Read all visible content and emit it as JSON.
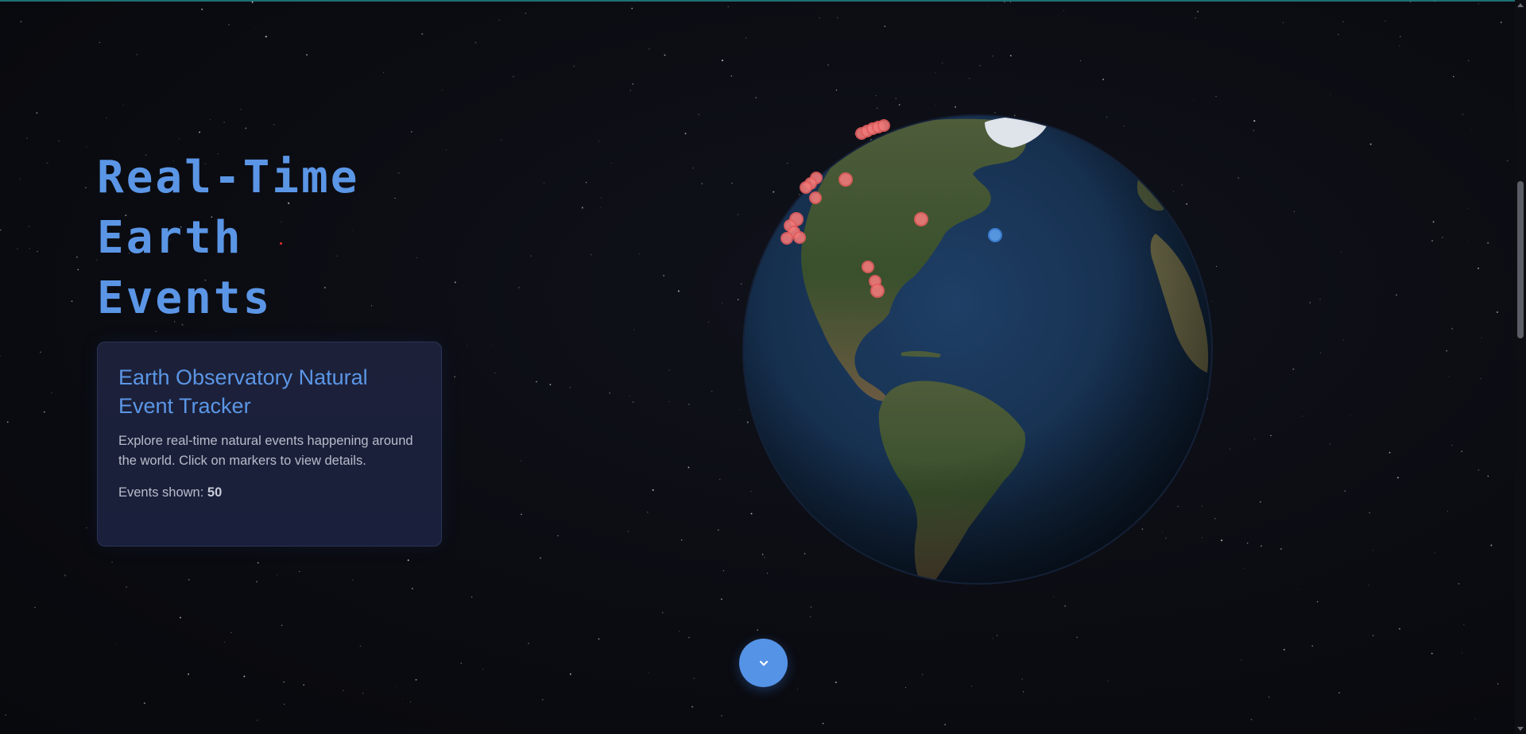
{
  "hero": {
    "title_lines": [
      "Real-Time",
      "Earth",
      "Events"
    ]
  },
  "info_card": {
    "title": "Earth Observatory Natural Event Tracker",
    "description": "Explore real-time natural events happening around the world. Click on markers to view details.",
    "count_label": "Events shown:",
    "count_value": "50"
  },
  "globe": {
    "marker_colors": {
      "wildfire": "#f07a7a",
      "storm": "#5a9be6"
    }
  },
  "icons": {
    "scroll_down": "chevron-down-icon"
  },
  "theme": {
    "accent": "#5b96e6",
    "background": "#0b0c12",
    "card_background": "#1c2139"
  }
}
